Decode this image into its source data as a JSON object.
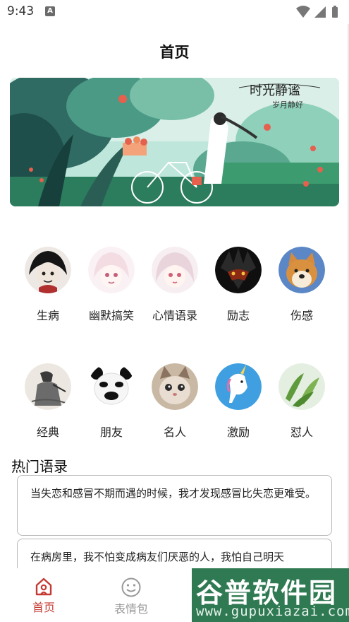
{
  "status": {
    "time": "9:43",
    "notification_icon": "A"
  },
  "header": {
    "title": "首页"
  },
  "banner": {
    "caption": "时光静谧",
    "sub_caption": "岁月静好"
  },
  "categories": [
    {
      "label": "生病",
      "icon": "avatar-dark-anime"
    },
    {
      "label": "幽默搞笑",
      "icon": "avatar-pink-anime"
    },
    {
      "label": "心情语录",
      "icon": "avatar-anime-girl"
    },
    {
      "label": "励志",
      "icon": "avatar-dark-hero"
    },
    {
      "label": "伤感",
      "icon": "avatar-shiba-dog"
    },
    {
      "label": "经典",
      "icon": "avatar-ink-painting"
    },
    {
      "label": "朋友",
      "icon": "avatar-panda-meme"
    },
    {
      "label": "名人",
      "icon": "avatar-cat"
    },
    {
      "label": "激励",
      "icon": "avatar-unicorn"
    },
    {
      "label": "怼人",
      "icon": "avatar-green-leaves"
    }
  ],
  "hot_section": {
    "title": "热门语录",
    "quotes": [
      "当失恋和感冒不期而遇的时候，我才发现感冒比失恋更难受。",
      "在病房里，我不怕变成病友们厌恶的人，我怕自己明天"
    ]
  },
  "tabs": [
    {
      "label": "首页",
      "icon": "home-icon",
      "active": true
    },
    {
      "label": "表情包",
      "icon": "smiley-icon",
      "active": false
    }
  ],
  "watermark": {
    "title": "谷普软件园",
    "url": "www.gupuxiazai.com"
  },
  "colors": {
    "accent": "#c53a33",
    "inactive": "#999999",
    "watermark_bg": "#2f7a52"
  }
}
